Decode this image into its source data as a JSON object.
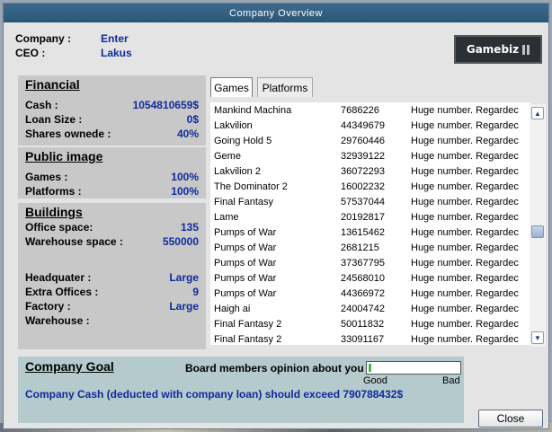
{
  "window": {
    "title": "Company Overview"
  },
  "header": {
    "company_label": "Company :",
    "company_value": "Enter",
    "ceo_label": "CEO :",
    "ceo_value": "Lakus",
    "logo_text": "Gamebiz"
  },
  "financial": {
    "title": "Financial",
    "rows": [
      {
        "label": "Cash :",
        "value": "1054810659$"
      },
      {
        "label": "Loan Size :",
        "value": "0$"
      },
      {
        "label": "Shares ownede :",
        "value": "40%"
      }
    ]
  },
  "public_image": {
    "title": "Public image",
    "rows": [
      {
        "label": "Games :",
        "value": "100%"
      },
      {
        "label": "Platforms :",
        "value": "100%"
      }
    ]
  },
  "buildings": {
    "title": "Buildings",
    "rows": [
      {
        "label": "Office space:",
        "value": "135"
      },
      {
        "label": "Warehouse space :",
        "value": "550000"
      }
    ],
    "details": [
      {
        "label": "Headquater :",
        "value": "Large"
      },
      {
        "label": "Extra Offices :",
        "value": "9"
      },
      {
        "label": "Factory :",
        "value": "Large"
      },
      {
        "label": "Warehouse :",
        "value": ""
      }
    ]
  },
  "tabs": [
    {
      "label": "Games",
      "active": true
    },
    {
      "label": "Platforms",
      "active": false
    }
  ],
  "games_list": [
    {
      "name": "Mankind Machina",
      "number": "7686226",
      "note": "Huge number. Regardec"
    },
    {
      "name": "Lakvilion",
      "number": "44349679",
      "note": "Huge number. Regardec"
    },
    {
      "name": "Going Hold 5",
      "number": "29760446",
      "note": "Huge number. Regardec"
    },
    {
      "name": "Geme",
      "number": "32939122",
      "note": "Huge number. Regardec"
    },
    {
      "name": "Lakvilion 2",
      "number": "36072293",
      "note": "Huge number. Regardec"
    },
    {
      "name": "The Dominator 2",
      "number": "16002232",
      "note": "Huge number. Regardec"
    },
    {
      "name": "Final Fantasy",
      "number": "57537044",
      "note": "Huge number. Regardec"
    },
    {
      "name": "Lame",
      "number": "20192817",
      "note": "Huge number. Regardec"
    },
    {
      "name": "Pumps of War",
      "number": "13615462",
      "note": "Huge number. Regardec"
    },
    {
      "name": "Pumps of War",
      "number": "2681215",
      "note": "Huge number. Regardec"
    },
    {
      "name": "Pumps of War",
      "number": "37367795",
      "note": "Huge number. Regardec"
    },
    {
      "name": "Pumps of War",
      "number": "24568010",
      "note": "Huge number. Regardec"
    },
    {
      "name": "Pumps of War",
      "number": "44366972",
      "note": "Huge number. Regardec"
    },
    {
      "name": "Haigh ai",
      "number": "24004742",
      "note": "Huge number. Regardec"
    },
    {
      "name": "Final Fantasy 2",
      "number": "50011832",
      "note": "Huge number. Regardec"
    },
    {
      "name": "Final Fantasy 2",
      "number": "33091167",
      "note": "Huge number. Regardec"
    }
  ],
  "goal": {
    "title": "Company Goal",
    "opinion_label": "Board members opinion about you :",
    "opinion_level": 0.02,
    "good_label": "Good",
    "bad_label": "Bad",
    "text": "Company Cash (deducted with company loan) should exceed 790788432$"
  },
  "buttons": {
    "close": "Close"
  },
  "colors": {
    "titlebar": "#2f5d80",
    "value_text": "#102a9c",
    "goal_panel": "#b4cacc",
    "opinion_fill": "#49b24c"
  }
}
